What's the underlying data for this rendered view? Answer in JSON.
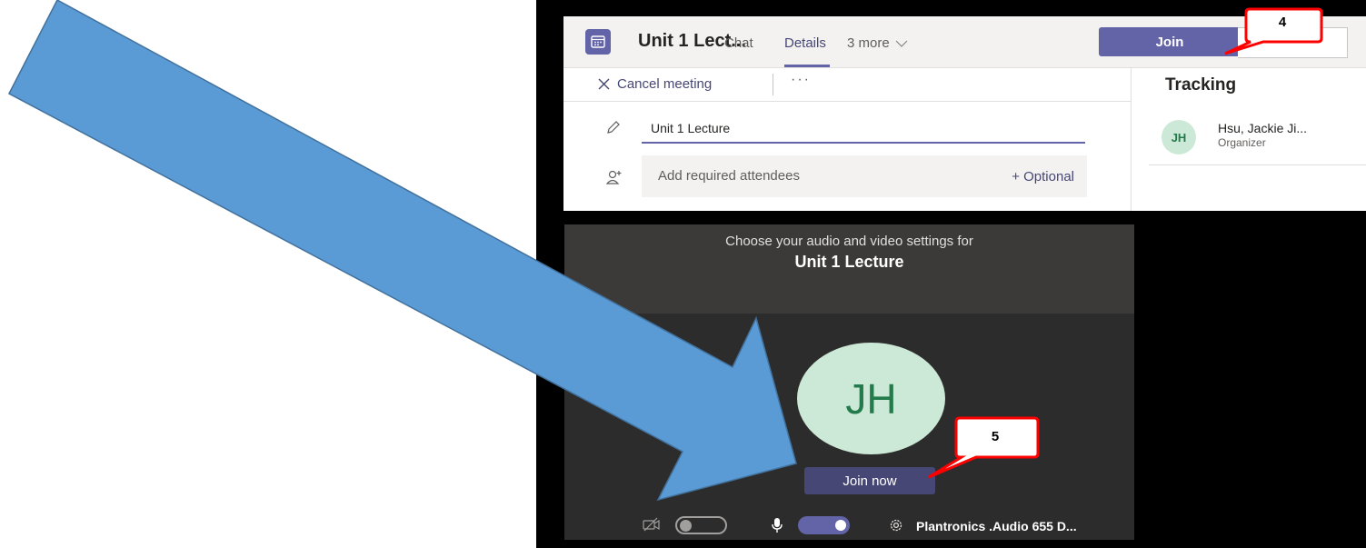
{
  "meeting": {
    "title": "Unit 1 Lect...",
    "tabs": [
      "Chat",
      "Details",
      "3 more"
    ],
    "join_label": "Join",
    "cancel_label": "Cancel meeting",
    "more_label": "···",
    "title_value": "Unit 1 Lecture",
    "attendees_placeholder": "Add required attendees",
    "optional_label": "+ Optional"
  },
  "tracking": {
    "heading": "Tracking",
    "organizer_initials": "JH",
    "organizer_name": "Hsu, Jackie Ji...",
    "organizer_role": "Organizer"
  },
  "prejoin": {
    "prompt": "Choose your audio and video settings for",
    "meeting_name": "Unit 1 Lecture",
    "avatar_initials": "JH",
    "join_now_label": "Join now",
    "camera_on": false,
    "mic_on": true,
    "audio_device": "Plantronics .Audio 655 D..."
  },
  "callouts": {
    "step4": "4",
    "step5": "5"
  },
  "colors": {
    "accent": "#6264a7",
    "arrow": "#5b9bd5",
    "callout_border": "#ff0000"
  }
}
